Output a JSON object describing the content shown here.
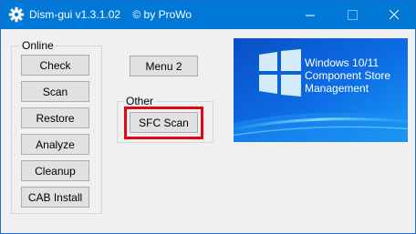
{
  "window": {
    "title": "Dism-gui v1.3.1.02    © by ProWo",
    "accent": "#0078d7"
  },
  "title_controls": {
    "minimize_icon": "minimize-icon",
    "maximize_icon": "maximize-icon",
    "close_icon": "close-icon"
  },
  "online_group": {
    "label": "Online",
    "buttons": [
      "Check",
      "Scan",
      "Restore",
      "Analyze",
      "Cleanup",
      "CAB Install"
    ]
  },
  "menu2_label": "Menu 2",
  "other_group": {
    "label": "Other",
    "sfc_label": "SFC Scan",
    "highlight_color": "#e30613"
  },
  "banner": {
    "lines": [
      "Windows 10/11",
      "Component Store",
      "Management"
    ],
    "logo_icon": "windows-logo-icon"
  }
}
